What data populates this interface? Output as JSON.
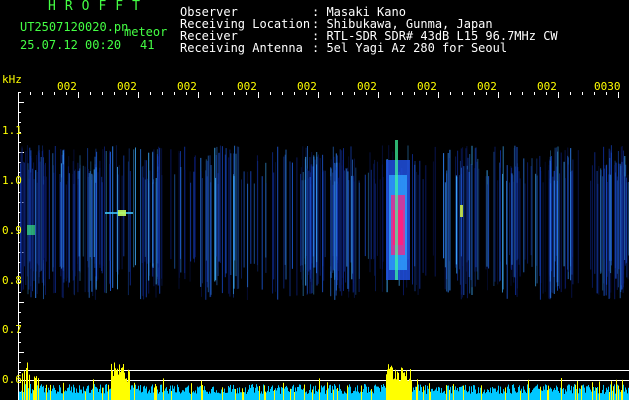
{
  "header": {
    "app_title": "HROFFT",
    "file_name": "UT2507120020.pn",
    "file_tag": "meteor",
    "date_time": "25.07.12 00:20",
    "count": "41"
  },
  "info": [
    {
      "key": "Observer",
      "value": ": Masaki Kano"
    },
    {
      "key": "Receiving Location",
      "value": ": Shibukawa, Gunma, Japan"
    },
    {
      "key": "Receiver",
      "value": ": RTL-SDR SDR# 43dB L15 96.7MHz CW"
    },
    {
      "key": "Receiving Antenna",
      "value": ": 5el Yagi Az 280 for Seoul"
    }
  ],
  "axis": {
    "unit": "kHz",
    "y_ticks": [
      "1.1",
      "1.0",
      "0.9",
      "0.8",
      "0.7",
      "0.6"
    ],
    "time_ticks": [
      "002",
      "002",
      "002",
      "002",
      "002",
      "002",
      "002",
      "002",
      "002",
      "0030"
    ]
  },
  "colors": {
    "label": "#ffff00",
    "title": "#44ff44",
    "text": "#ffffff",
    "grid": "#ffffff",
    "background": "#000000",
    "meter_cyan": "#00c8ff",
    "meter_yellow": "#ffff00"
  }
}
